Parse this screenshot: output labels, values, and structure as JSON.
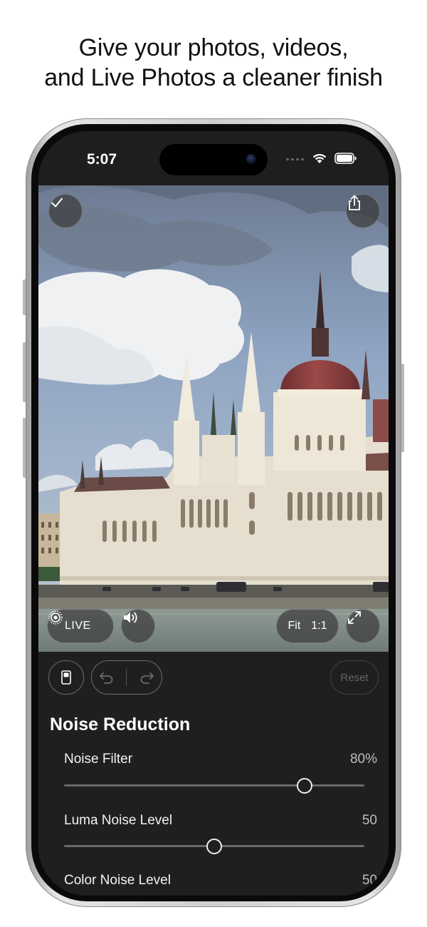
{
  "headline": {
    "line1": "Give your photos, videos,",
    "line2": "and Live Photos a cleaner finish"
  },
  "status_bar": {
    "time": "5:07",
    "icons": [
      "signal-icon",
      "wifi-icon",
      "battery-icon"
    ]
  },
  "photo_overlay": {
    "done_icon": "checkmark-icon",
    "share_icon": "share-icon",
    "live_label": "LIVE",
    "live_icon": "live-photo-icon",
    "sound_icon": "speaker-icon",
    "fit_label": "Fit",
    "one_to_one_label": "1:1",
    "expand_icon": "expand-icon"
  },
  "toolbar": {
    "compare_icon": "compare-icon",
    "undo_icon": "undo-icon",
    "redo_icon": "redo-icon",
    "reset_label": "Reset"
  },
  "section": {
    "title": "Noise Reduction",
    "sliders": [
      {
        "label": "Noise Filter",
        "value": "80%",
        "fraction": 0.8
      },
      {
        "label": "Luma Noise Level",
        "value": "50",
        "fraction": 0.5
      },
      {
        "label": "Color Noise Level",
        "value": "50",
        "fraction": 0.5
      }
    ]
  },
  "colors": {
    "panel_bg": "#1f1f1f",
    "accent_white": "#ffffff",
    "dome": "#8a3f3e"
  }
}
